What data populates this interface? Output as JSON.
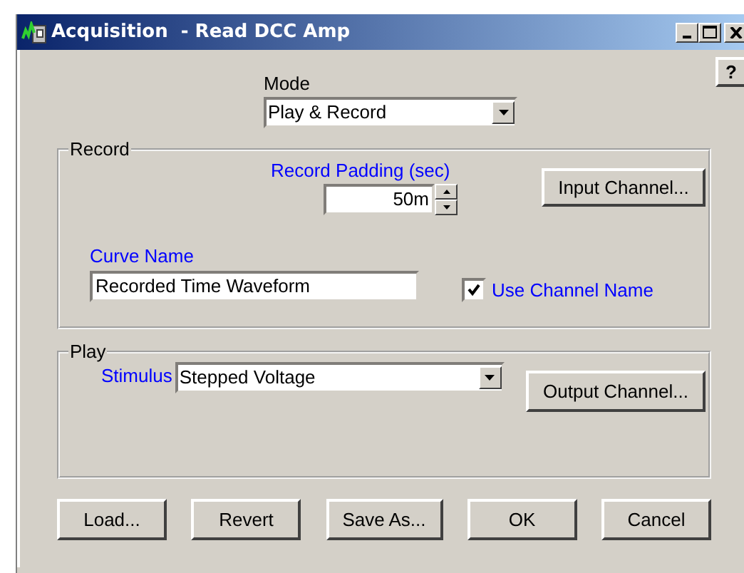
{
  "window": {
    "title": "Acquisition  - Read DCC Amp"
  },
  "help_button": "?",
  "mode": {
    "label": "Mode",
    "value": "Play & Record"
  },
  "record": {
    "title": "Record",
    "padding_label": "Record Padding (sec)",
    "padding_value": "50m",
    "input_channel_button": "Input Channel...",
    "curve_name_label": "Curve Name",
    "curve_name_value": "Recorded Time Waveform",
    "use_channel_name": {
      "label": "Use Channel Name",
      "checked": true
    }
  },
  "play": {
    "title": "Play",
    "stimulus_label": "Stimulus",
    "stimulus_value": "Stepped Voltage",
    "output_channel_button": "Output Channel..."
  },
  "buttons": [
    "Load...",
    "Revert",
    "Save As...",
    "OK",
    "Cancel"
  ]
}
